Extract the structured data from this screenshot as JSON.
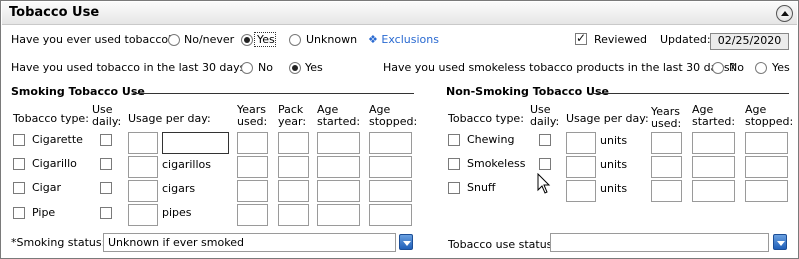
{
  "header": {
    "title": "Tobacco Use"
  },
  "q1": {
    "label": "Have you ever used tobacco?",
    "options": [
      "No/never",
      "Yes",
      "Unknown"
    ],
    "selected": "Yes"
  },
  "exclusions": {
    "label": "Exclusions"
  },
  "reviewed": {
    "label": "Reviewed",
    "checked": true
  },
  "updated": {
    "label": "Updated:",
    "date": "02/25/2020"
  },
  "q2": {
    "label": "Have you used tobacco in the last 30 days?",
    "options": [
      "No",
      "Yes"
    ],
    "selected": "Yes"
  },
  "q3": {
    "label": "Have you used smokeless tobacco products in the last 30 days?",
    "options": [
      "No",
      "Yes"
    ],
    "selected": null
  },
  "smoking": {
    "title": "Smoking Tobacco Use",
    "headers": {
      "type": "Tobacco type:",
      "use_daily": "Use daily:",
      "usage": "Usage per day:",
      "years": "Years used:",
      "pack": "Pack year:",
      "age_started": "Age started:",
      "age_stopped": "Age stopped:"
    },
    "rows": [
      {
        "type": "Cigarette",
        "unit": ""
      },
      {
        "type": "Cigarillo",
        "unit": "cigarillos"
      },
      {
        "type": "Cigar",
        "unit": "cigars"
      },
      {
        "type": "Pipe",
        "unit": "pipes"
      }
    ],
    "status_label": "*Smoking status:",
    "status_value": "Unknown if ever smoked"
  },
  "nonsmoking": {
    "title": "Non-Smoking Tobacco Use",
    "headers": {
      "type": "Tobacco type:",
      "use_daily": "Use daily:",
      "usage": "Usage per day:",
      "years": "Years used:",
      "age_started": "Age started:",
      "age_stopped": "Age stopped:"
    },
    "rows": [
      {
        "type": "Chewing",
        "unit": "units"
      },
      {
        "type": "Smokeless",
        "unit": "units"
      },
      {
        "type": "Snuff",
        "unit": "units"
      }
    ],
    "status_label": "Tobacco use status:",
    "status_value": ""
  }
}
